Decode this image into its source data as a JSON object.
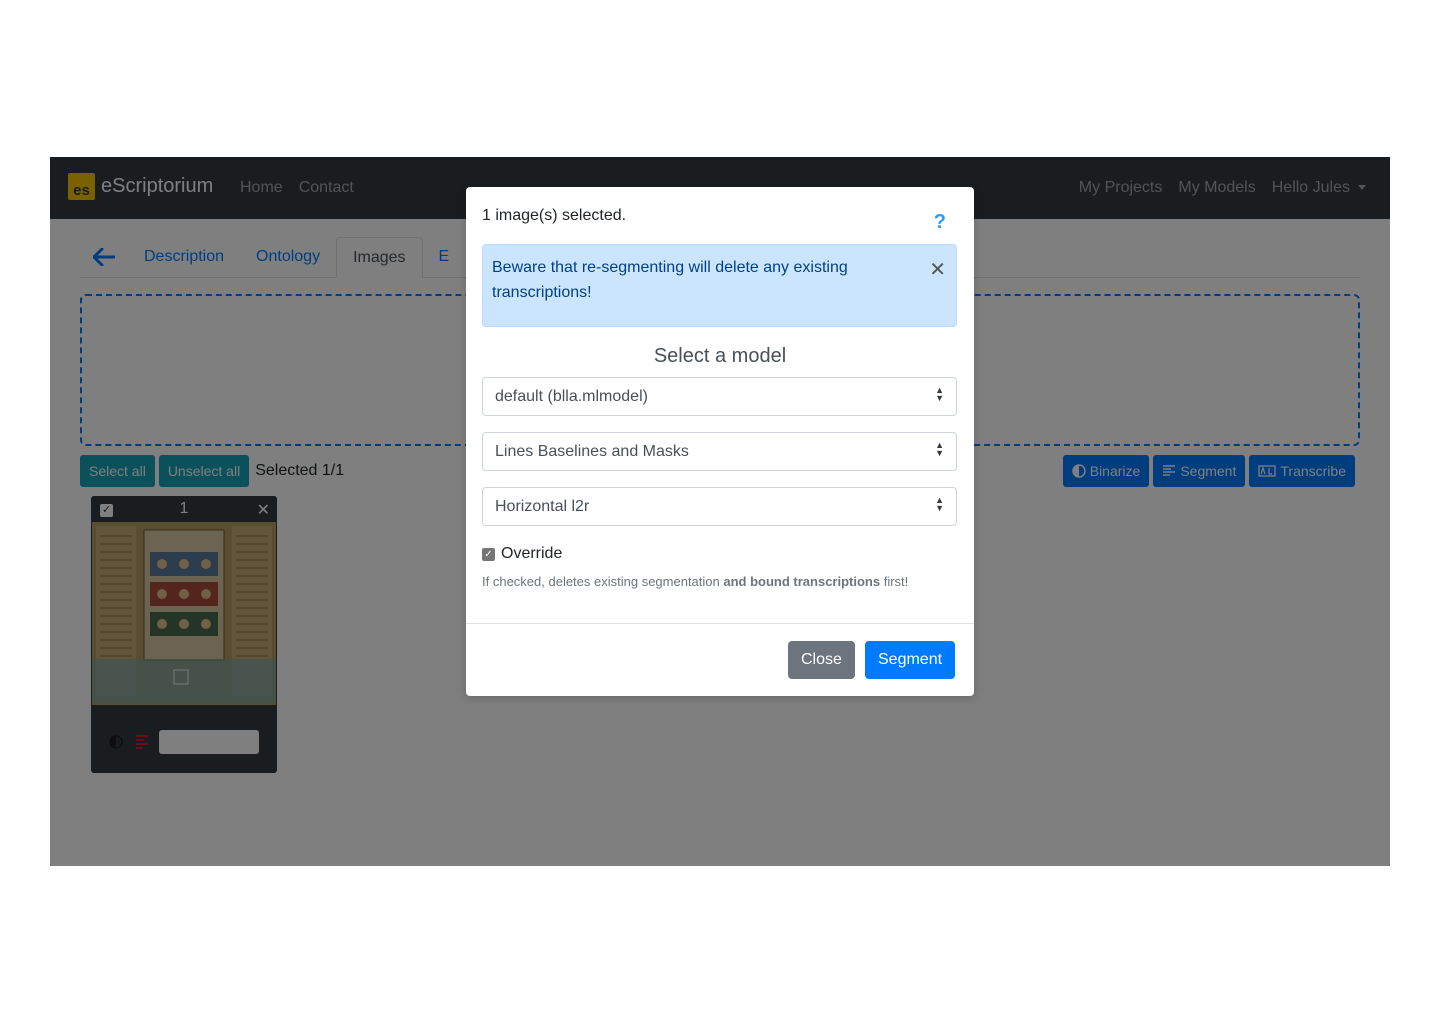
{
  "navbar": {
    "brand_logo": "es",
    "brand": "eScriptorium",
    "left_links": [
      "Home",
      "Contact"
    ],
    "right_links": [
      "My Projects",
      "My Models"
    ],
    "user_menu": "Hello Jules"
  },
  "tabs": {
    "back_icon": "arrow-left-icon",
    "items": [
      "Description",
      "Ontology",
      "Images",
      "E"
    ],
    "active": "Images"
  },
  "toolbar": {
    "select_all": "Select all",
    "unselect_all": "Unselect all",
    "selected": "Selected 1/1",
    "binarize": "Binarize",
    "segment": "Segment",
    "transcribe": "Transcribe"
  },
  "card": {
    "number": "1",
    "checked": true
  },
  "modal": {
    "title": "1 image(s) selected.",
    "help_icon": "?",
    "alert": "Beware that re-segmenting will delete any existing transcriptions!",
    "heading": "Select a model",
    "model_select": "default (blla.mlmodel)",
    "steps_select": "Lines Baselines and Masks",
    "direction_select": "Horizontal l2r",
    "override_label": "Override",
    "override_checked": true,
    "help_prefix": "If checked, deletes existing segmentation ",
    "help_bold": "and bound transcriptions",
    "help_suffix": " first!",
    "close_button": "Close",
    "segment_button": "Segment"
  },
  "colors": {
    "navbar_bg": "#343a40",
    "primary": "#007bff",
    "teal": "#17a2b8",
    "alert_bg": "#cce5ff",
    "alert_text": "#004085",
    "secondary": "#6c757d"
  }
}
